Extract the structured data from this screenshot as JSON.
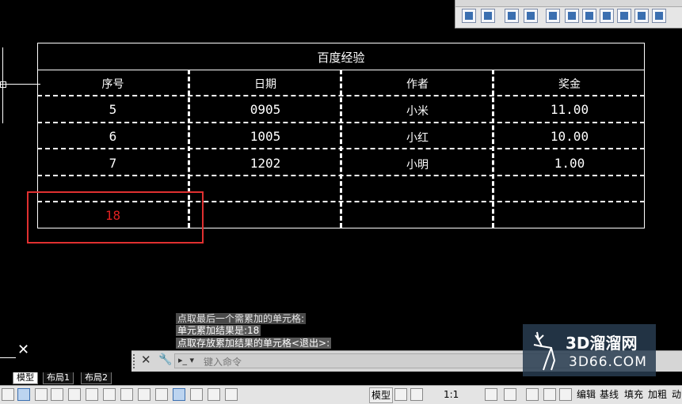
{
  "table": {
    "title": "百度经验",
    "headers": [
      "序号",
      "日期",
      "作者",
      "奖金"
    ],
    "rows": [
      [
        "5",
        "0905",
        "小米",
        "11.00"
      ],
      [
        "6",
        "1005",
        "小红",
        "10.00"
      ],
      [
        "7",
        "1202",
        "小明",
        "1.00"
      ]
    ],
    "result_value": "18"
  },
  "command_history": [
    "点取最后一个需累加的单元格:",
    "单元累加结果是:18",
    "点取存放累加结果的单元格<退出>:"
  ],
  "command_line": {
    "placeholder": "键入命令",
    "close_icon": "close-icon",
    "settings_icon": "wrench-icon"
  },
  "layout_tabs": [
    "模型",
    "布局1",
    "布局2"
  ],
  "status_bar": {
    "model_label": "模型",
    "scale_label": "1:1",
    "buttons": [
      "编辑",
      "基线",
      "填充",
      "加粗",
      "动"
    ]
  },
  "watermark": {
    "brand": "3D溜溜网",
    "domain": "3D66.COM"
  },
  "colors": {
    "background": "#000000",
    "highlight_box": "#e03030",
    "result_text": "#e02020"
  }
}
